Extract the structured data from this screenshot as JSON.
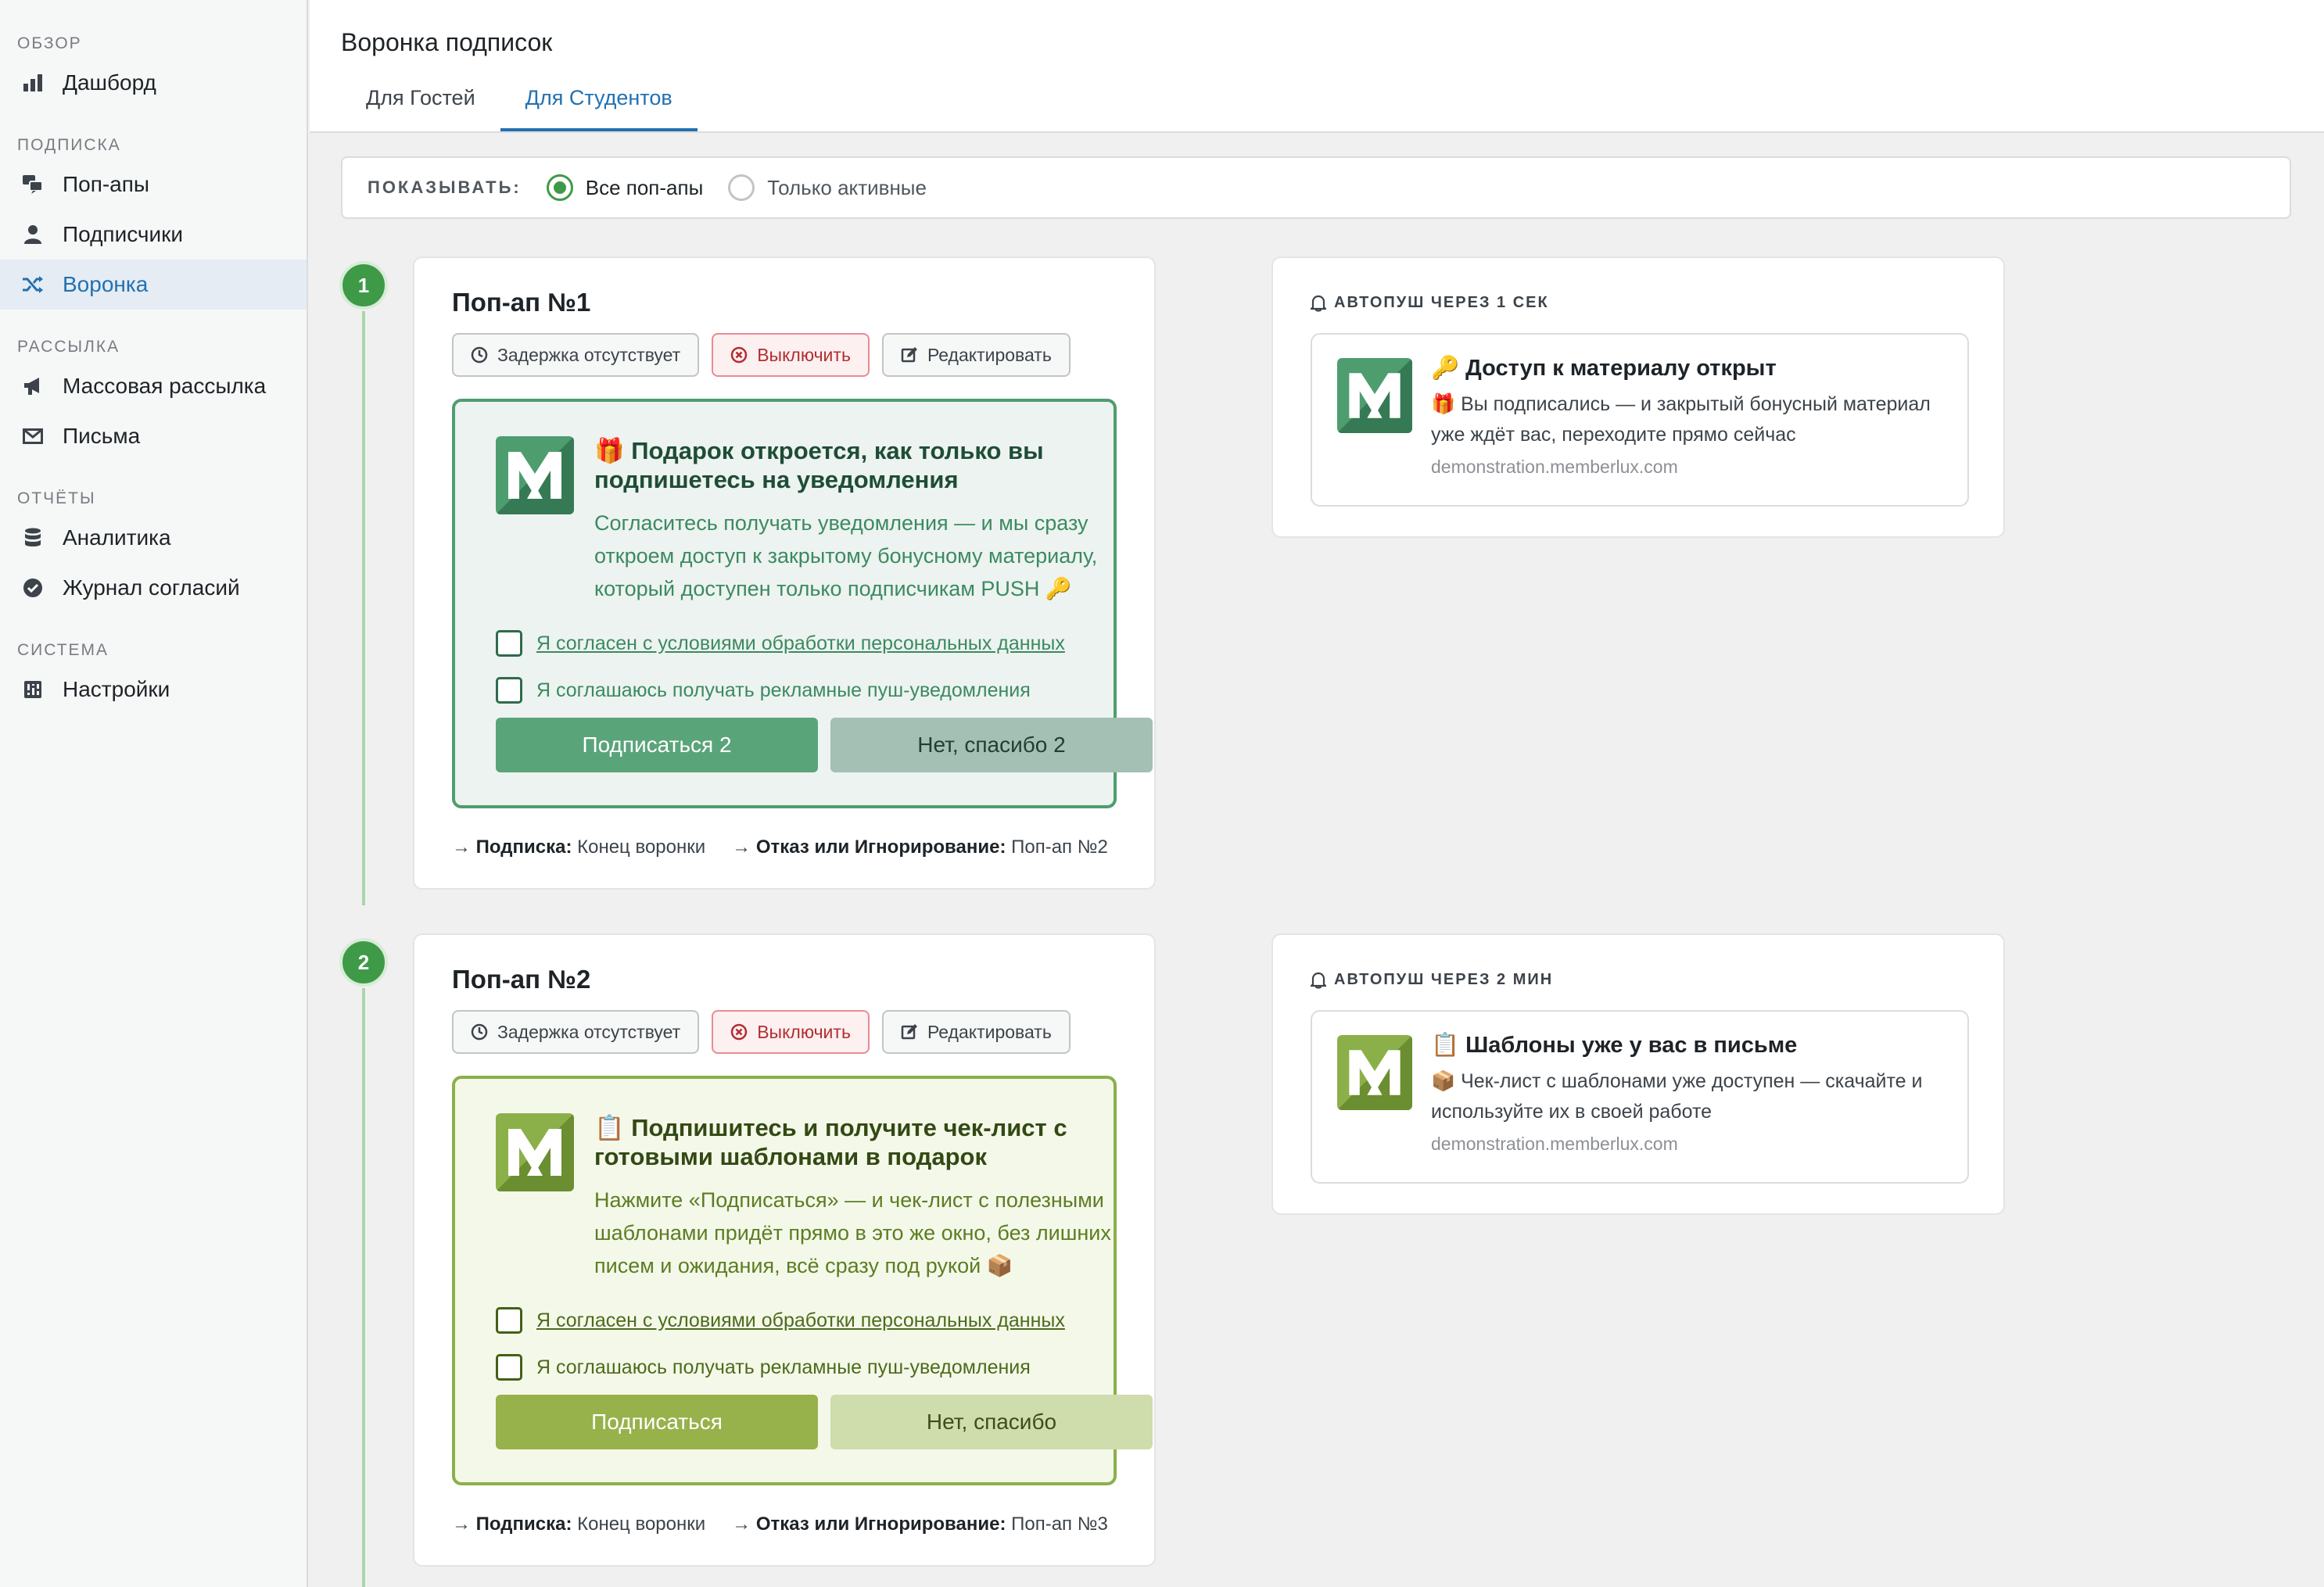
{
  "sidebar": {
    "sections": [
      {
        "title": "ОБЗОР",
        "items": [
          {
            "label": "Дашборд",
            "icon": "bar-chart-icon"
          }
        ]
      },
      {
        "title": "ПОДПИСКА",
        "items": [
          {
            "label": "Поп-апы",
            "icon": "megaphone-chat-icon"
          },
          {
            "label": "Подписчики",
            "icon": "user-icon"
          },
          {
            "label": "Воронка",
            "icon": "shuffle-icon",
            "active": true
          }
        ]
      },
      {
        "title": "РАССЫЛКА",
        "items": [
          {
            "label": "Массовая рассылка",
            "icon": "megaphone-icon"
          },
          {
            "label": "Письма",
            "icon": "envelope-icon"
          }
        ]
      },
      {
        "title": "ОТЧЁТЫ",
        "items": [
          {
            "label": "Аналитика",
            "icon": "database-icon"
          },
          {
            "label": "Журнал согласий",
            "icon": "check-circle-icon"
          }
        ]
      },
      {
        "title": "СИСТЕМА",
        "items": [
          {
            "label": "Настройки",
            "icon": "settings-icon"
          }
        ]
      }
    ]
  },
  "header": {
    "title": "Воронка подписок",
    "tabs": [
      {
        "label": "Для Гостей"
      },
      {
        "label": "Для Студентов",
        "active": true
      }
    ]
  },
  "filter": {
    "label": "ПОКАЗЫВАТЬ:",
    "options": [
      {
        "label": "Все поп-апы",
        "selected": true
      },
      {
        "label": "Только активные",
        "selected": false
      }
    ]
  },
  "colors": {
    "accent": "#2271b1",
    "step_green": "#3f9a47",
    "danger": "#b32d2e"
  },
  "steps": [
    {
      "number": "1",
      "title": "Поп-ап №1",
      "delay_label": "Задержка отсутствует",
      "disable_label": "Выключить",
      "edit_label": "Редактировать",
      "preview": {
        "theme": "green",
        "title": "🎁 Подарок откроется, как только вы подпишетесь на уведомления",
        "text": "Согласитесь получать уведомления — и мы сразу откроем доступ к закрытому бонусному материалу, который доступен только подписчикам PUSH 🔑",
        "consent_1": "Я согласен с условиями обработки персональных данных",
        "consent_2": "Я соглашаюсь получать рекламные пуш-уведомления",
        "subscribe_label": "Подписаться 2",
        "decline_label": "Нет, спасибо 2"
      },
      "route_subscribe_label": "Подписка:",
      "route_subscribe_value": "Конец воронки",
      "route_decline_label": "Отказ или Игнорирование:",
      "route_decline_value": "Поп-ап №2",
      "push": {
        "label": "АВТОПУШ ЧЕРЕЗ 1 СЕК",
        "title": "🔑 Доступ к материалу открыт",
        "body": "🎁 Вы подписались — и закрытый бонусный материал уже ждёт вас, переходите прямо сейчас",
        "domain": "demonstration.memberlux.com"
      }
    },
    {
      "number": "2",
      "title": "Поп-ап №2",
      "delay_label": "Задержка отсутствует",
      "disable_label": "Выключить",
      "edit_label": "Редактировать",
      "preview": {
        "theme": "olive",
        "title": "📋 Подпишитесь и получите чек-лист с готовыми шаблонами в подарок",
        "text": "Нажмите «Подписаться» — и чек-лист с полезными шаблонами придёт прямо в это же окно, без лишних писем и ожидания, всё сразу под рукой 📦",
        "consent_1": "Я согласен с условиями обработки персональных данных",
        "consent_2": "Я соглашаюсь получать рекламные пуш-уведомления",
        "subscribe_label": "Подписаться",
        "decline_label": "Нет, спасибо"
      },
      "route_subscribe_label": "Подписка:",
      "route_subscribe_value": "Конец воронки",
      "route_decline_label": "Отказ или Игнорирование:",
      "route_decline_value": "Поп-ап №3",
      "push": {
        "label": "АВТОПУШ ЧЕРЕЗ 2 МИН",
        "title": "📋 Шаблоны уже у вас в письме",
        "body": "📦 Чек-лист с шаблонами уже доступен — скачайте и используйте их в своей работе",
        "domain": "demonstration.memberlux.com"
      }
    }
  ]
}
